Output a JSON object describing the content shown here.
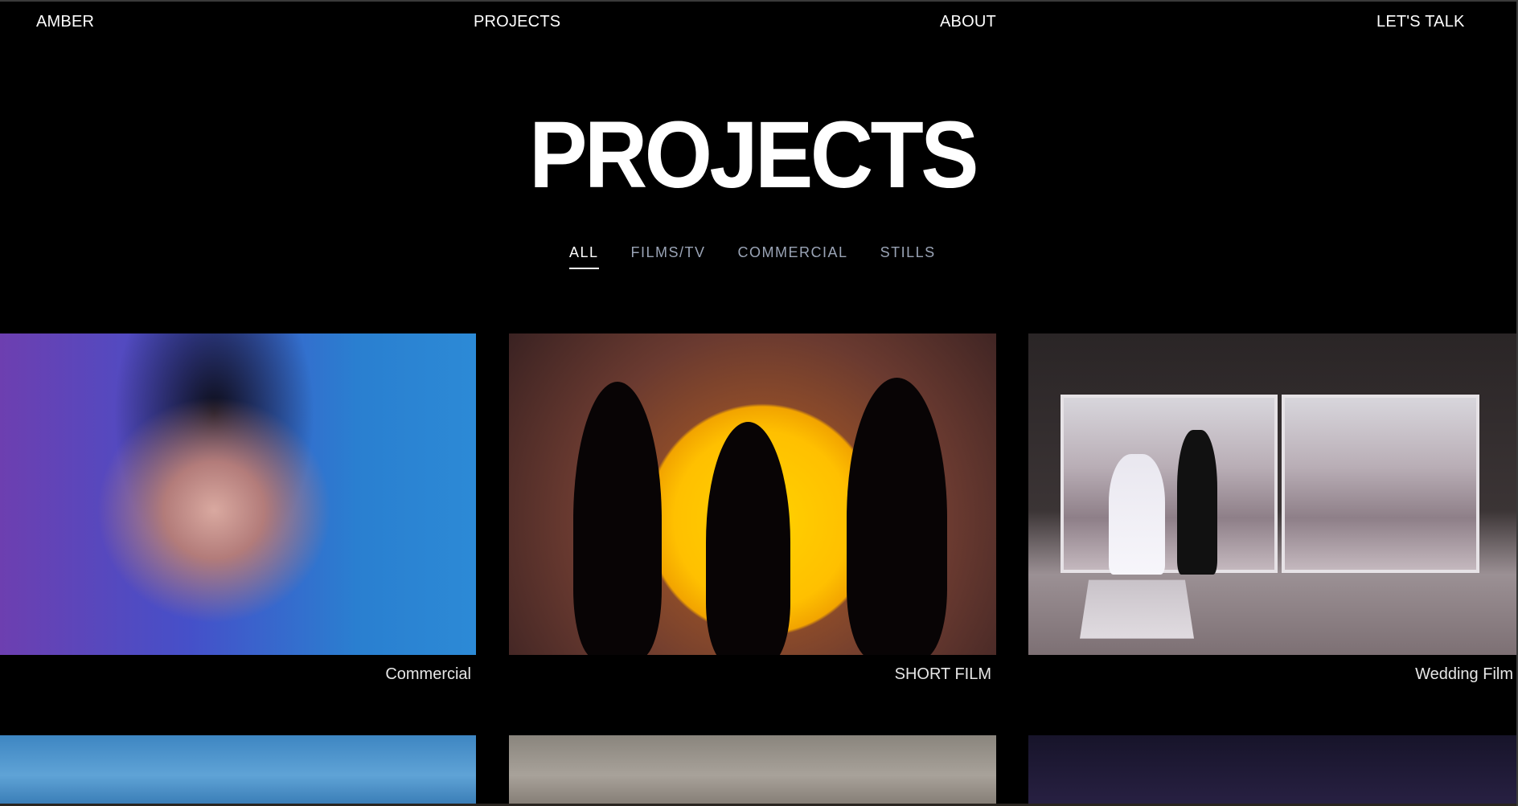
{
  "nav": {
    "brand": "AMBER",
    "projects": "PROJECTS",
    "about": "ABOUT",
    "talk": "LET'S TALK"
  },
  "page_title": "PROJECTS",
  "filters": {
    "items": [
      {
        "label": "ALL",
        "active": true
      },
      {
        "label": "FILMS/TV",
        "active": false
      },
      {
        "label": "COMMERCIAL",
        "active": false
      },
      {
        "label": "STILLS",
        "active": false
      }
    ]
  },
  "projects": [
    {
      "label": "Commercial"
    },
    {
      "label": "SHORT FILM"
    },
    {
      "label": "Wedding Film"
    }
  ]
}
